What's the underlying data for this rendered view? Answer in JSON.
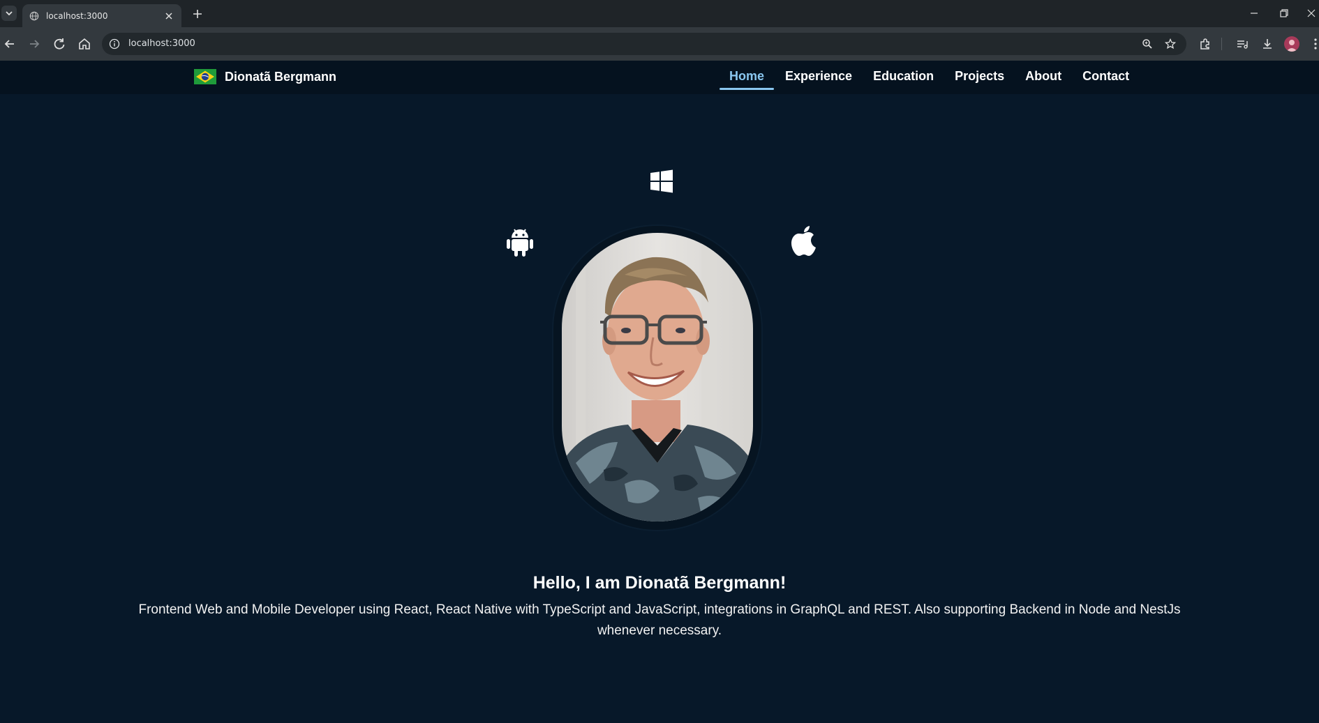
{
  "browser": {
    "tab_title": "localhost:3000",
    "url": "localhost:3000",
    "icons": [
      "tab-list-icon",
      "globe-icon",
      "close-icon",
      "plus-icon",
      "back-icon",
      "forward-icon",
      "reload-icon",
      "home-icon",
      "info-icon",
      "zoom-icon",
      "bookmark-star-icon",
      "extensions-icon",
      "media-control-icon",
      "download-icon",
      "profile-avatar-icon",
      "more-menu-icon",
      "minimize-icon",
      "restore-icon",
      "window-close-icon"
    ]
  },
  "site": {
    "brand_name": "Dionatã Bergmann",
    "nav": [
      {
        "label": "Home",
        "active": true
      },
      {
        "label": "Experience",
        "active": false
      },
      {
        "label": "Education",
        "active": false
      },
      {
        "label": "Projects",
        "active": false
      },
      {
        "label": "About",
        "active": false
      },
      {
        "label": "Contact",
        "active": false
      }
    ],
    "accent_color": "#8ac7f0",
    "background_color": "#071829"
  },
  "hero": {
    "icons": [
      "windows-icon",
      "android-icon",
      "apple-icon"
    ],
    "title": "Hello, I am Dionatã Bergmann!",
    "description": "Frontend Web and Mobile Developer using React, React Native with TypeScript and JavaScript, integrations in GraphQL and REST. Also supporting Backend in Node and NestJs whenever necessary."
  }
}
